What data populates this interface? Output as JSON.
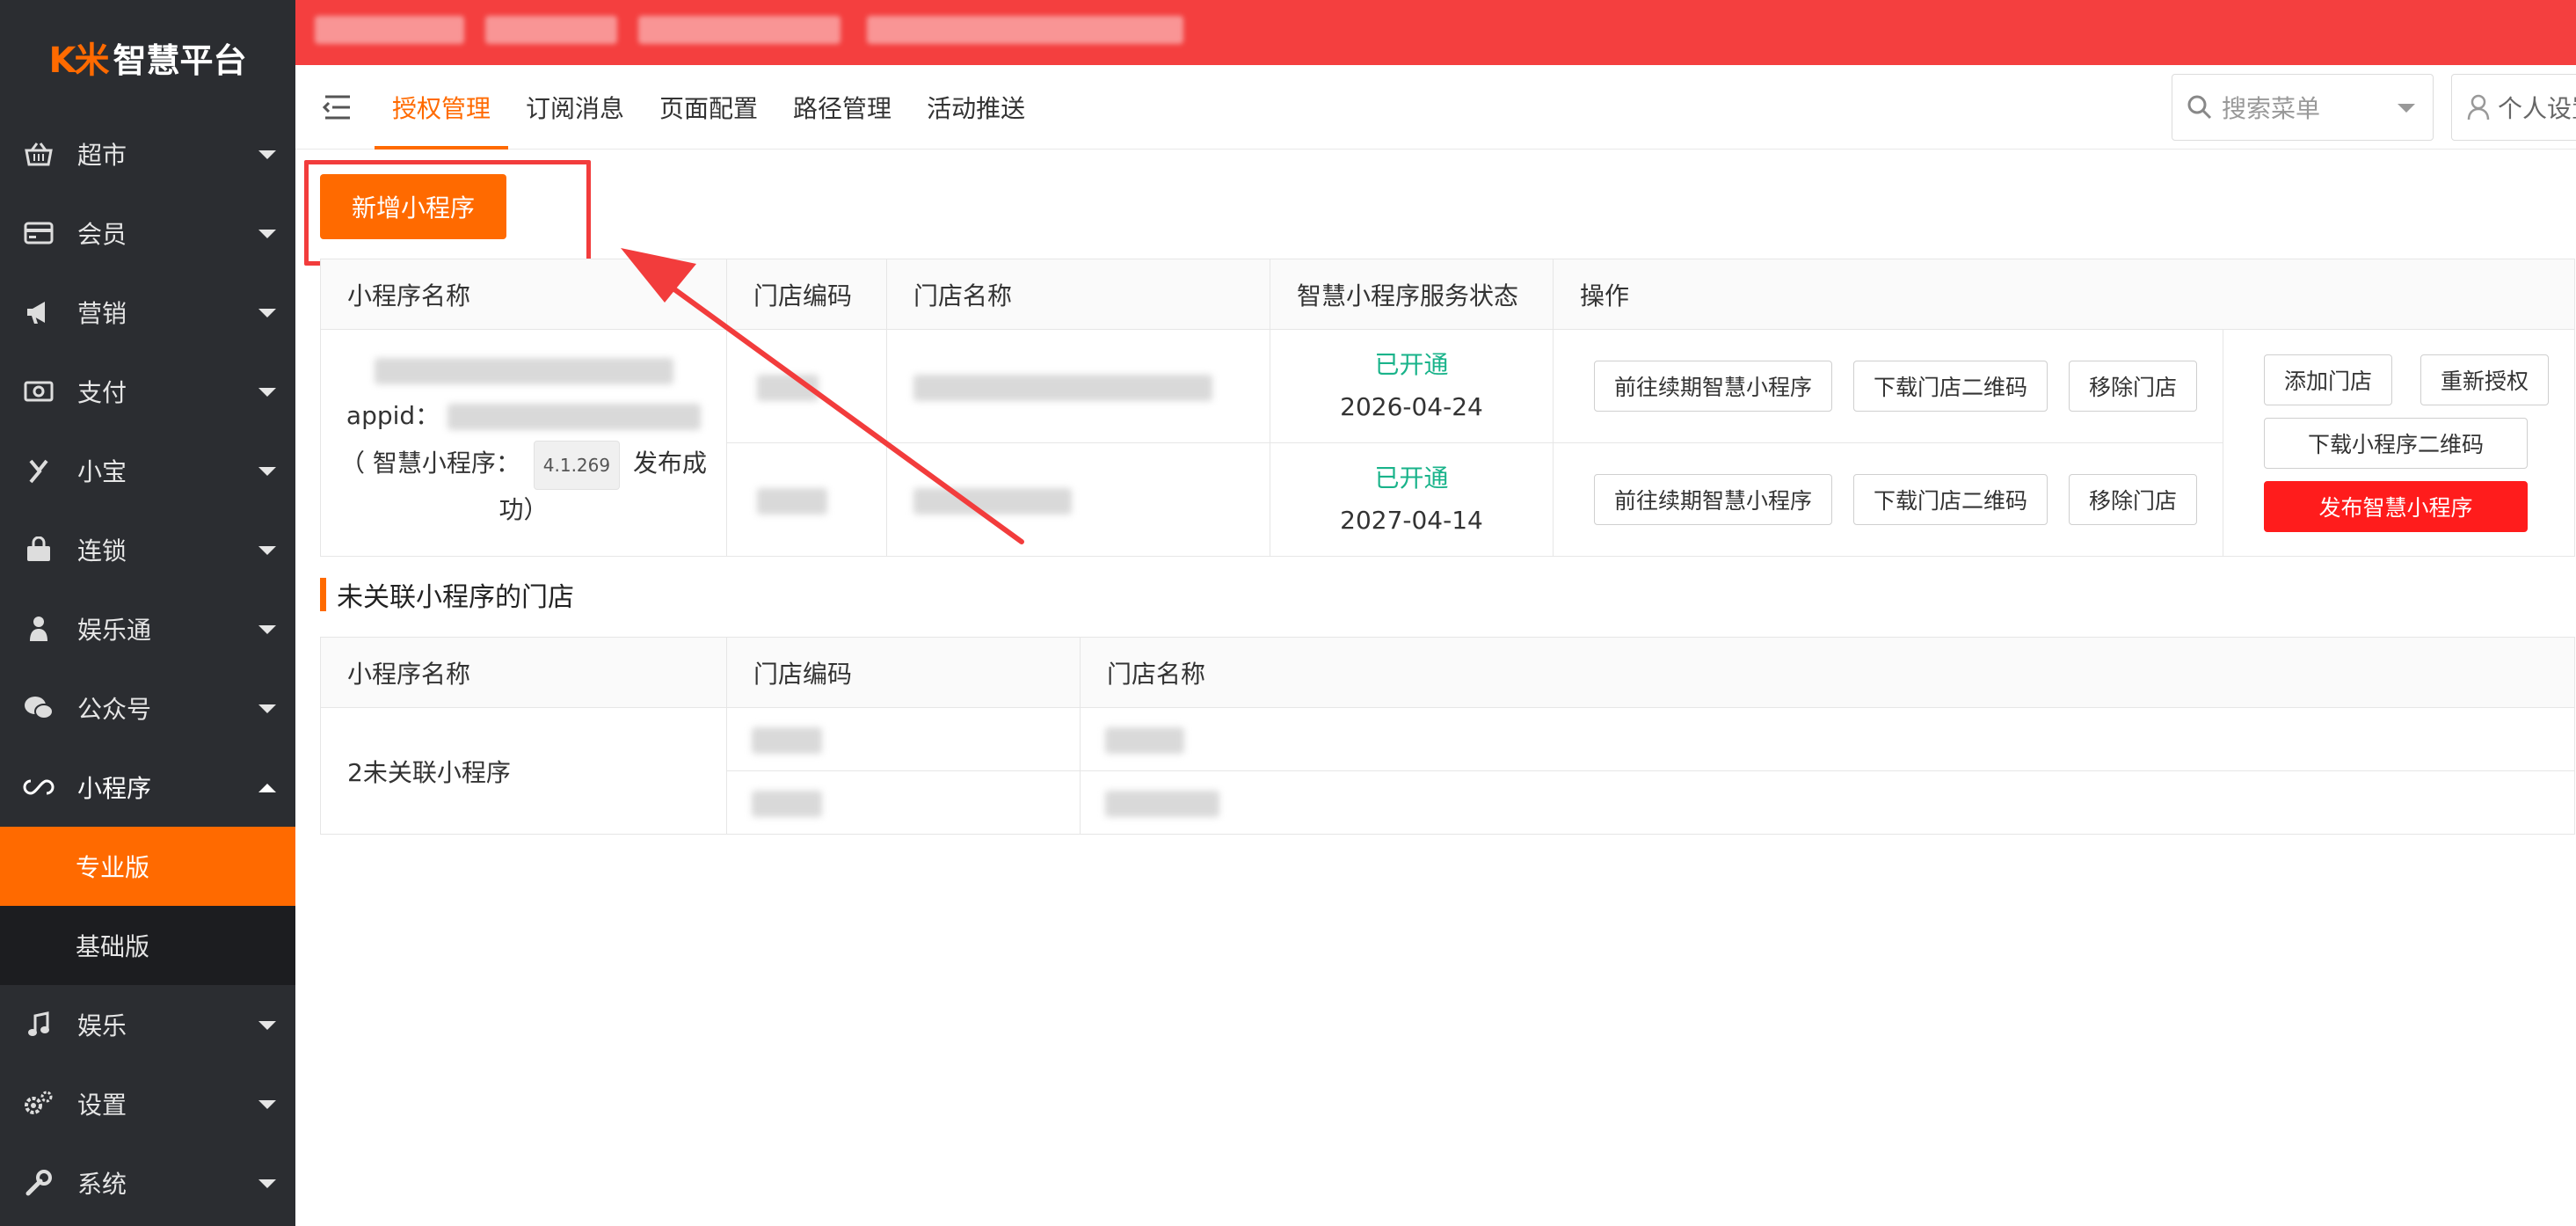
{
  "brand": {
    "mark": "K米",
    "name": "智慧平台"
  },
  "sidebar": {
    "items": [
      {
        "label": "超市",
        "icon": "basket-icon"
      },
      {
        "label": "会员",
        "icon": "card-icon"
      },
      {
        "label": "营销",
        "icon": "megaphone-icon"
      },
      {
        "label": "支付",
        "icon": "cash-icon"
      },
      {
        "label": "小宝",
        "icon": "bot-icon"
      },
      {
        "label": "连锁",
        "icon": "bag-icon"
      },
      {
        "label": "娱乐通",
        "icon": "figure-icon"
      },
      {
        "label": "公众号",
        "icon": "wechat-icon"
      },
      {
        "label": "小程序",
        "icon": "miniprogram-icon",
        "expanded": true,
        "children": [
          {
            "label": "专业版",
            "active": true
          },
          {
            "label": "基础版"
          }
        ]
      },
      {
        "label": "娱乐",
        "icon": "music-icon"
      },
      {
        "label": "设置",
        "icon": "gears-icon"
      },
      {
        "label": "系统",
        "icon": "wrench-icon"
      }
    ]
  },
  "tabs": [
    "授权管理",
    "订阅消息",
    "页面配置",
    "路径管理",
    "活动推送"
  ],
  "active_tab": "授权管理",
  "header": {
    "search_placeholder": "搜索菜单",
    "personal": "个人设置"
  },
  "toolbar": {
    "add_label": "新增小程序"
  },
  "auth_table": {
    "headers": [
      "小程序名称",
      "门店编码",
      "门店名称",
      "智慧小程序服务状态",
      "操作"
    ],
    "app": {
      "appid_label": "appid：",
      "desc_prefix": "（ 智慧小程序：",
      "version": "4.1.269",
      "desc_suffix": "发布成功）"
    },
    "rows": [
      {
        "status": "已开通",
        "date": "2026-04-24"
      },
      {
        "status": "已开通",
        "date": "2027-04-14"
      }
    ],
    "row_actions": [
      "前往续期智慧小程序",
      "下载门店二维码",
      "移除门店"
    ],
    "app_actions": {
      "add_store": "添加门店",
      "reauth": "重新授权",
      "download_qr": "下载小程序二维码",
      "publish": "发布智慧小程序"
    }
  },
  "unlinked": {
    "title": "未关联小程序的门店",
    "headers": [
      "小程序名称",
      "门店编码",
      "门店名称"
    ],
    "name": "2未关联小程序"
  },
  "colors": {
    "accent": "#ff6a00",
    "banner": "#f43f3f",
    "status_ok": "#19b38a",
    "danger": "#ff1c1c",
    "sidebar": "#2b2d31"
  }
}
